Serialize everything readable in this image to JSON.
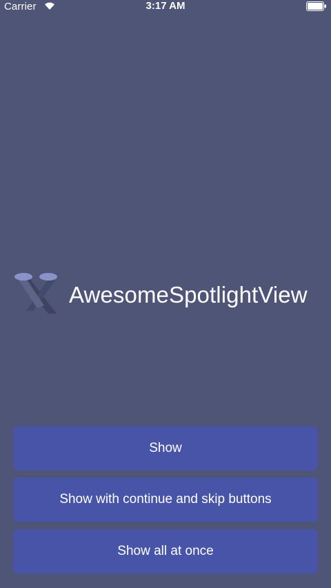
{
  "status_bar": {
    "carrier": "Carrier",
    "time": "3:17 AM",
    "wifi_icon": "wifi-icon",
    "battery_icon": "battery-icon"
  },
  "brand": {
    "logo_icon": "spotlight-logo-icon",
    "title": "AwesomeSpotlightView"
  },
  "buttons": {
    "show": "Show",
    "show_with_continue": "Show with continue and skip buttons",
    "show_all": "Show all at once"
  },
  "colors": {
    "background": "#4e5576",
    "button": "#4854a7",
    "text": "#ffffff"
  }
}
